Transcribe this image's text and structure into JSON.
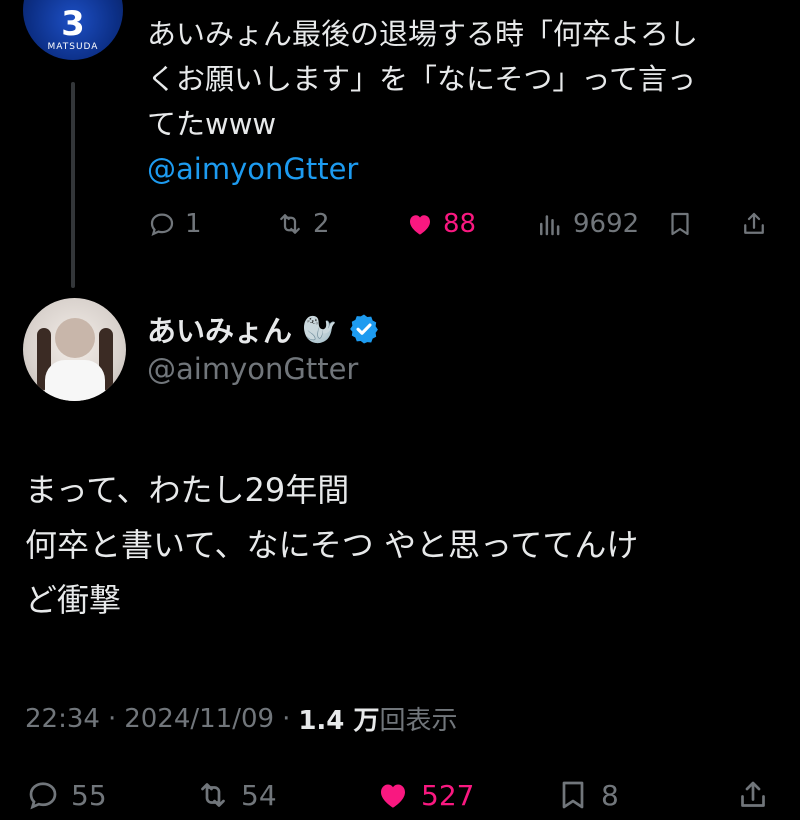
{
  "parent_tweet": {
    "avatar": {
      "jersey_number": "3",
      "jersey_name": "MATSUDA"
    },
    "text_lines": [
      "あいみょん最後の退場する時「何卒よろし",
      "くお願いします」を「なにそつ」って言っ",
      "てたwww"
    ],
    "mention": "@aimyonGtter",
    "actions": {
      "reply_count": "1",
      "retweet_count": "2",
      "like_count": "88",
      "view_count": "9692"
    },
    "like_color": "#f91880"
  },
  "main_tweet": {
    "display_name": "あいみょん",
    "name_emoji": "🦭",
    "verified_color": "#1d9bf0",
    "handle": "@aimyonGtter",
    "text_lines": [
      "まって、わたし29年間",
      "何卒と書いて、なにそつ やと思っててんけ",
      "ど衝撃"
    ],
    "meta": {
      "time": "22:34",
      "date": "2024/11/09",
      "views": "1.4 万",
      "views_label": "回表示"
    },
    "actions": {
      "reply_count": "55",
      "retweet_count": "54",
      "like_count": "527",
      "bookmark_count": "8"
    }
  }
}
